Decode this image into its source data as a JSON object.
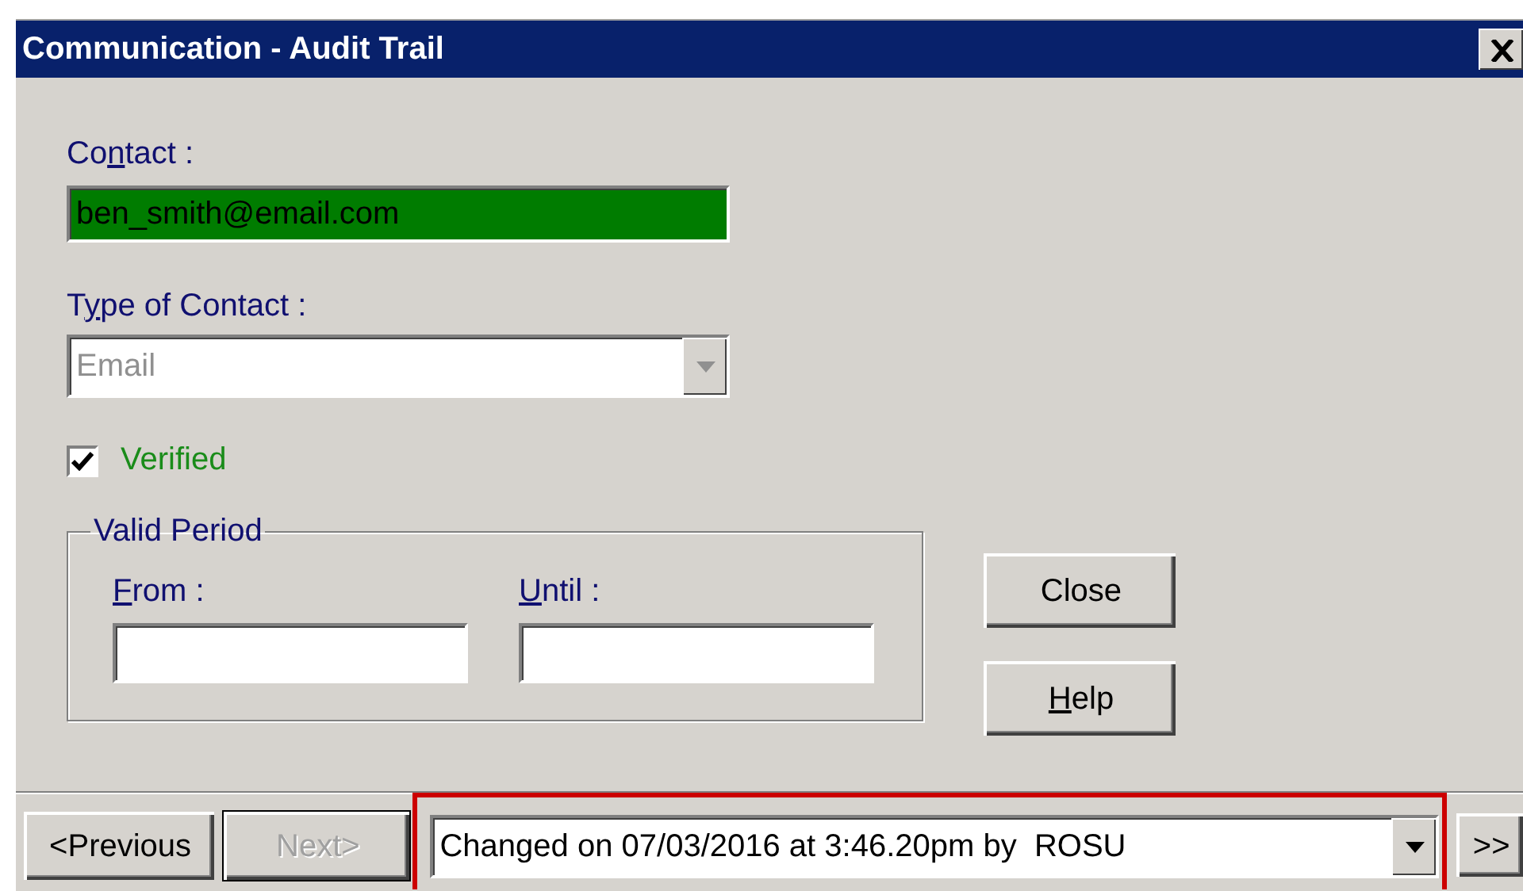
{
  "window": {
    "title": "Communication - Audit Trail"
  },
  "contact": {
    "label": {
      "before": "Co",
      "key": "n",
      "after": "tact :"
    },
    "value": "ben_smith@email.com"
  },
  "type_of_contact": {
    "label": {
      "before": "T",
      "key": "y",
      "after": "pe of Contact :"
    },
    "value": "Email",
    "disabled": true
  },
  "verified": {
    "label": "Verified",
    "checked": true
  },
  "valid_period": {
    "title": "Valid Period",
    "fields": [
      {
        "label": {
          "key": "F",
          "after": "rom :"
        }
      },
      {
        "label": {
          "key": "U",
          "after": "ntil :"
        }
      }
    ]
  },
  "buttons": [
    {
      "label": {
        "after": "Close"
      }
    },
    {
      "label": {
        "key": "H",
        "after": "elp"
      }
    }
  ],
  "navigation": {
    "buttons": [
      {
        "label": "<Previous",
        "disabled": false
      },
      {
        "label": "Next>",
        "disabled": true
      }
    ],
    "history": {
      "value": "Changed on 07/03/2016 at 3:46.20pm by  ROSU",
      "highlighted": true
    },
    "more": {
      "label": ">>"
    }
  }
}
